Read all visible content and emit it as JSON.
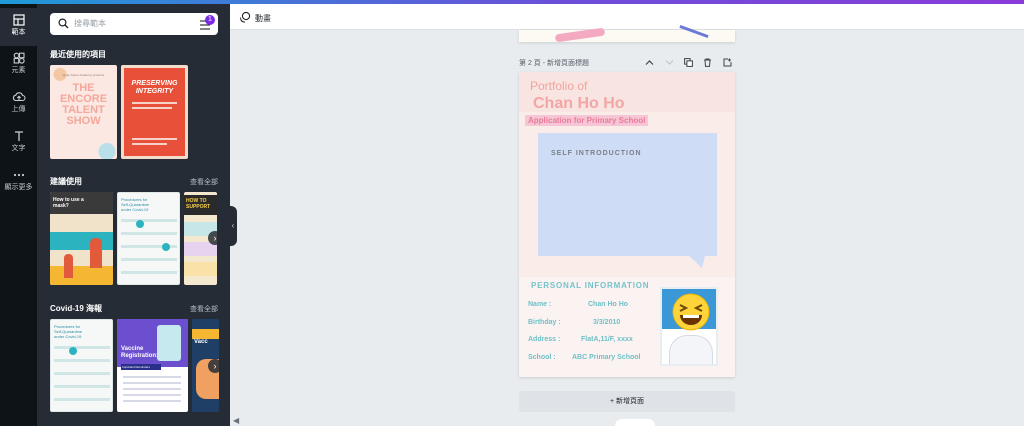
{
  "rail": {
    "items": [
      {
        "label": "範本",
        "icon": "layout-icon"
      },
      {
        "label": "元素",
        "icon": "shapes-icon"
      },
      {
        "label": "上傳",
        "icon": "cloud-upload-icon"
      },
      {
        "label": "文字",
        "icon": "text-icon"
      },
      {
        "label": "顯示更多",
        "icon": "more-dots-icon"
      }
    ]
  },
  "panel": {
    "search_placeholder": "搜尋範本",
    "filter_badge": "1",
    "recent_title": "最近使用的項目",
    "suggested_title": "建議使用",
    "suggested_see_all": "查看全部",
    "covid_title": "Covid-19 海報",
    "covid_see_all": "查看全部",
    "recent_thumbs": {
      "t1": {
        "line1": "Ignite Talent Academy presents",
        "title": "THE ENCORE TALENT SHOW"
      },
      "t2": {
        "line1": "",
        "title": "PRESERVING INTEGRITY"
      }
    },
    "suggested_thumbs": {
      "t1": {
        "title": "How to use a mask?"
      },
      "t2": {
        "title": "Procedures for Self-Quarantine under Covid-19"
      },
      "t3": {
        "title": "HOW TO SUPPORT"
      }
    },
    "covid_thumbs": {
      "t1": {
        "title": "Procedures for Self-Quarantine under Covid-19"
      },
      "t2": {
        "title": "Vaccine Registration:",
        "sub": "Important Reminders"
      },
      "t3": {
        "title": "Vacc"
      }
    }
  },
  "toolbar": {
    "animate_label": "動畫"
  },
  "editor": {
    "page_label": "第 2 頁 - 新增頁面標題",
    "add_page_label": "+ 新增頁面"
  },
  "design": {
    "portfolio_of": "Portfolio of",
    "name": "Chan Ho Ho",
    "application": "Application for Primary School",
    "self_intro": "SELF INTRODUCTION",
    "personal_info": "PERSONAL INFORMATION",
    "rows": [
      {
        "key": "Name :",
        "value": "Chan Ho Ho"
      },
      {
        "key": "Birthday :",
        "value": "3/3/2010"
      },
      {
        "key": "Address :",
        "value": "FlatA,11/F, xxxx"
      },
      {
        "key": "School :",
        "value": "ABC Primary School"
      }
    ]
  },
  "colors": {
    "accent": "#7d2ae8",
    "design_pink": "#f7c9c9",
    "design_blue": "#cfdcf6",
    "design_teal": "#5fc4c6"
  }
}
